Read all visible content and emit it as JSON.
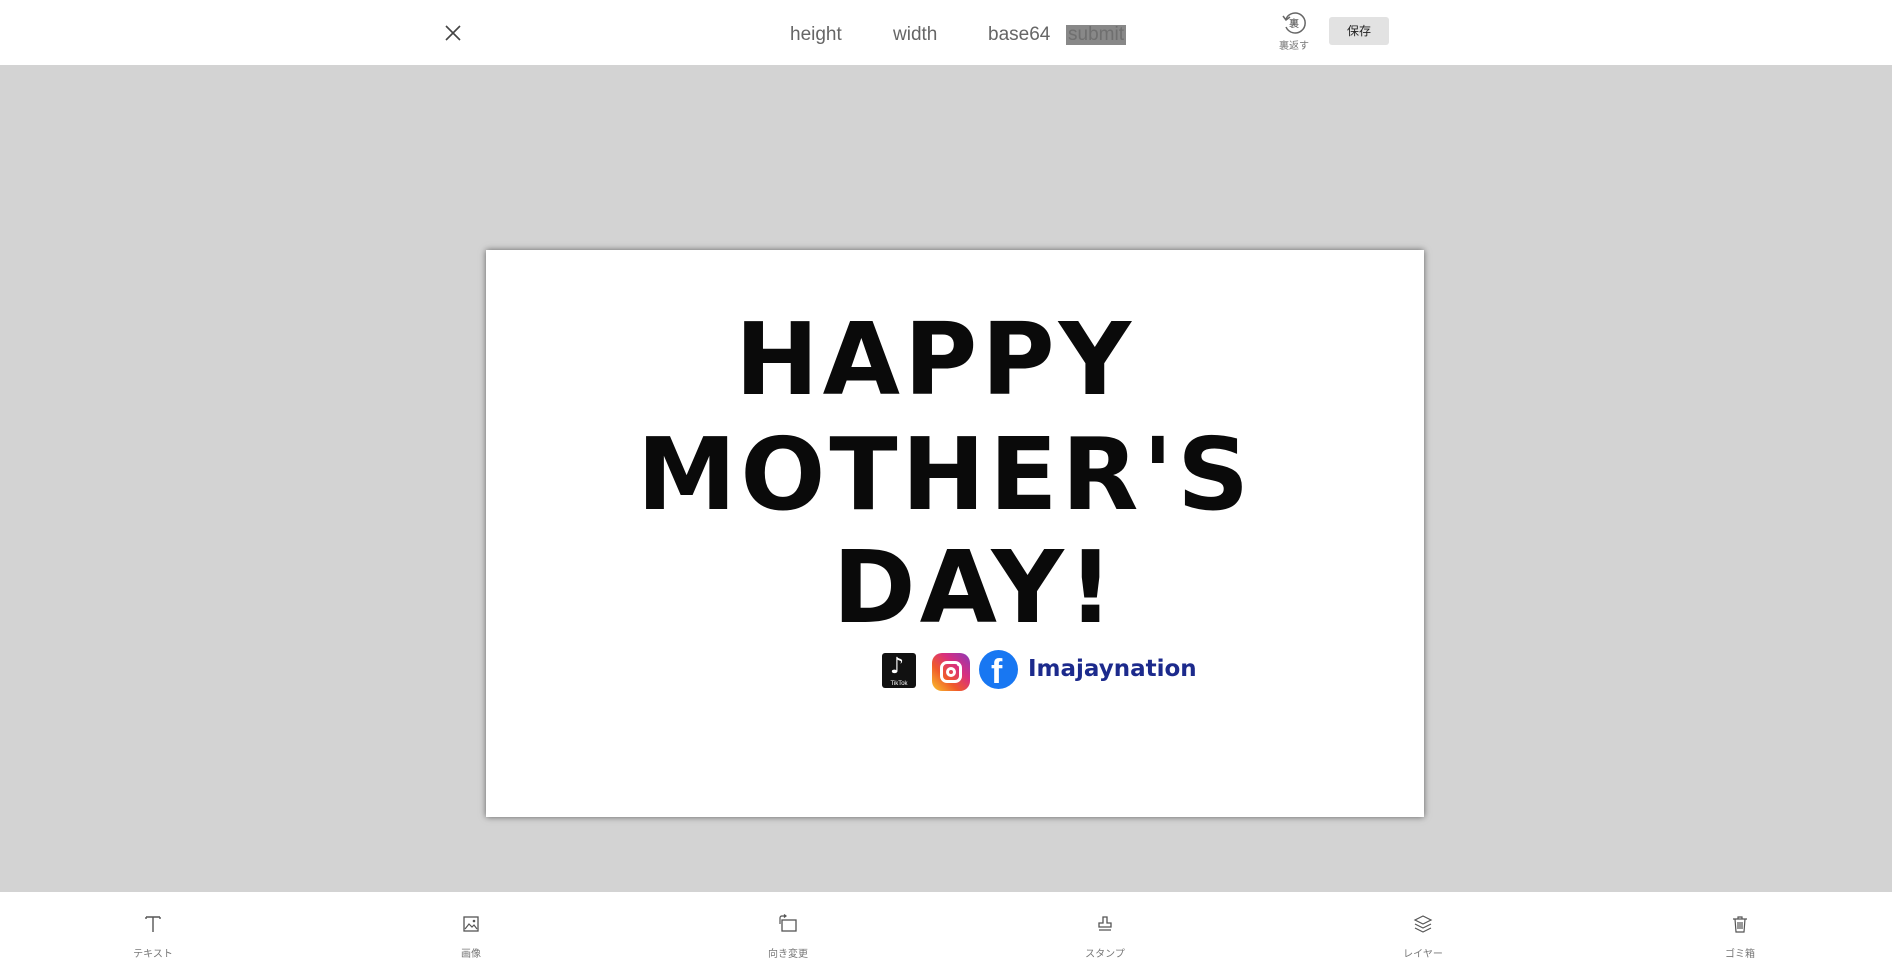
{
  "topbar": {
    "close_icon": "close-icon",
    "fields": {
      "height": "height",
      "width": "width",
      "base64": "base64"
    },
    "submit_label": "submit",
    "flip": {
      "icon": "flip-reverse-icon",
      "icon_glyph": "裏",
      "label": "裏返す"
    },
    "save_label": "保存"
  },
  "canvas": {
    "headline": [
      "HAPPY",
      "MOTHER'S",
      "DAY!"
    ],
    "social": {
      "tiktok_label": "TikTok",
      "handle": "Imajaynation"
    }
  },
  "toolbar": {
    "text": {
      "icon": "text-icon",
      "label": "テキスト"
    },
    "image": {
      "icon": "image-icon",
      "label": "画像"
    },
    "rotate": {
      "icon": "rotate-orientation-icon",
      "label": "向き変更"
    },
    "stamp": {
      "icon": "stamp-icon",
      "label": "スタンプ"
    },
    "layer": {
      "icon": "layers-icon",
      "label": "レイヤー"
    },
    "trash": {
      "icon": "trash-icon",
      "label": "ゴミ箱"
    }
  },
  "colors": {
    "background": "#d3d3d3",
    "bars": "#ffffff",
    "submit_bg": "#888888",
    "save_bg": "#e2e2e2",
    "headline": "#0a0a0a",
    "handle": "#1c2a8c",
    "facebook": "#1877f2"
  }
}
